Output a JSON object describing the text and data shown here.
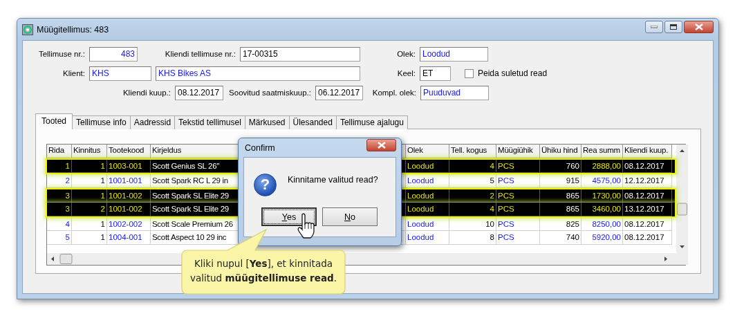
{
  "window": {
    "title": "Müügitellimus: 483"
  },
  "form": {
    "order_number": {
      "label": "Tellimuse nr.:",
      "value": "483"
    },
    "customer_order_number": {
      "label": "Kliendi tellimuse nr.:",
      "value": "17-00315"
    },
    "status": {
      "label": "Olek:",
      "value": "Loodud"
    },
    "customer": {
      "label": "Klient:",
      "code": "KHS",
      "name": "KHS Bikes AS"
    },
    "language": {
      "label": "Keel:",
      "value": "ET"
    },
    "hide_closed": {
      "label": "Peida suletud read",
      "checked": false
    },
    "customer_date": {
      "label": "Kliendi kuup.:",
      "value": "08.12.2017"
    },
    "requested_ship_date": {
      "label": "Soovitud saatmiskuup.:",
      "value": "06.12.2017"
    },
    "completion_status": {
      "label": "Kompl. olek:",
      "value": "Puuduvad"
    }
  },
  "tabs": [
    {
      "label": "Tooted",
      "selected": true
    },
    {
      "label": "Tellimuse info",
      "selected": false
    },
    {
      "label": "Aadressid",
      "selected": false
    },
    {
      "label": "Tekstid tellimusel",
      "selected": false
    },
    {
      "label": "Märkused",
      "selected": false
    },
    {
      "label": "Ülesanded",
      "selected": false
    },
    {
      "label": "Tellimuse ajalugu",
      "selected": false
    }
  ],
  "table": {
    "columns": [
      "Rida",
      "Kinnitus",
      "Tootekood",
      "Kirjeldus",
      "Olek",
      "Tell. kogus",
      "Müügiühik",
      "Ühiku hind",
      "Rea summ",
      "Kliendi kuup."
    ],
    "rows": [
      {
        "selected": true,
        "cells": [
          "1",
          "1",
          "1003-001",
          "Scott Genius SL 26''",
          "Loodud",
          "4",
          "PCS",
          "760",
          "2888,00",
          "08.12.2017"
        ]
      },
      {
        "selected": false,
        "cells": [
          "2",
          "1",
          "1001-001",
          "Scott Spark RC L 29 in",
          "Loodud",
          "5",
          "PCS",
          "915",
          "4575,00",
          "12.12.2017"
        ]
      },
      {
        "selected": true,
        "cells": [
          "3",
          "1",
          "1001-002",
          "Scott Spark SL Elite 29",
          "Loodud",
          "2",
          "PCS",
          "865",
          "1730,00",
          "08.12.2017"
        ]
      },
      {
        "selected": true,
        "cells": [
          "3",
          "2",
          "1001-002",
          "Scott Spark SL Elite 29",
          "Loodud",
          "4",
          "PCS",
          "865",
          "3460,00",
          "13.12.2017"
        ]
      },
      {
        "selected": false,
        "cells": [
          "4",
          "1",
          "1002-002",
          "Scott Scale Premium 26",
          "Loodud",
          "10",
          "PCS",
          "825",
          "8250,00",
          "08.12.2017"
        ]
      },
      {
        "selected": false,
        "cells": [
          "5",
          "1",
          "1004-001",
          "Scott Aspect 10 29 inc",
          "Loodud",
          "8",
          "PCS",
          "740",
          "5920,00",
          "08.12.2017"
        ]
      }
    ]
  },
  "dialog": {
    "title": "Confirm",
    "icon": "?",
    "message": "Kinnitame valitud read?",
    "buttons": [
      {
        "label": "Yes",
        "focused": true
      },
      {
        "label": "No",
        "focused": false
      }
    ]
  },
  "callout": {
    "text": "Kliki nupul [**Yes**], et kinnitada valitud **müügitellimuse read**."
  }
}
